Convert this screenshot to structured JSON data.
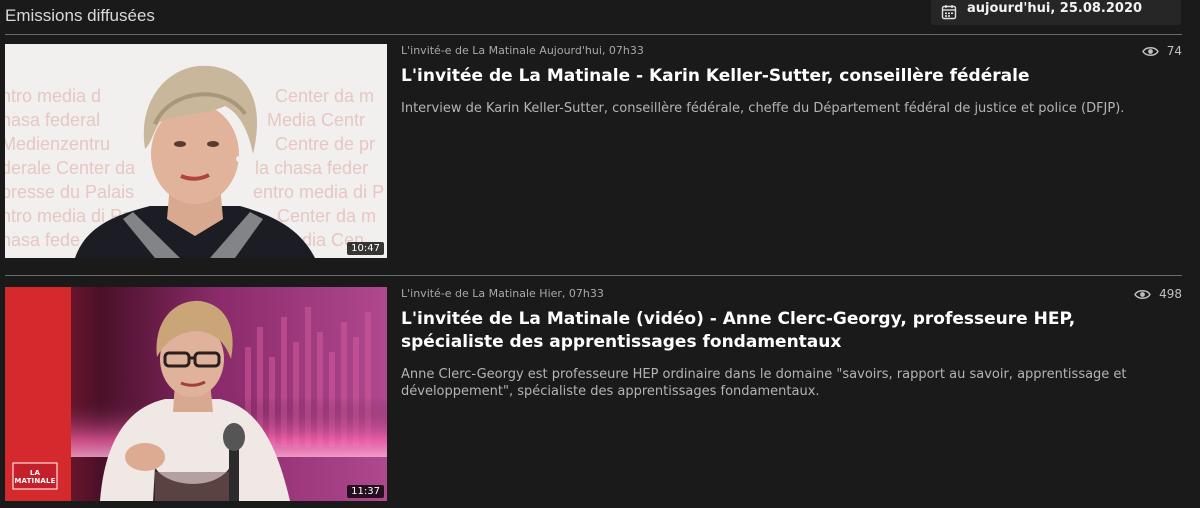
{
  "header": {
    "section_title": "Emissions diffusées",
    "date_label": "aujourd'hui, 25.08.2020",
    "date_icon": "calendar-icon"
  },
  "episodes": [
    {
      "meta": "L'invité-e de La Matinale Aujourd'hui, 07h33",
      "views": "74",
      "title": "L'invitée de La Matinale - Karin Keller-Sutter, conseillère fédérale",
      "description": "Interview de Karin Keller-Sutter, conseillère fédérale, cheffe du Département fédéral de justice et police (DFJP).",
      "duration": "10:47",
      "thumbnail": "press-conference-speaker"
    },
    {
      "meta": "L'invité-e de La Matinale Hier, 07h33",
      "views": "498",
      "title": "L'invitée de La Matinale (vidéo) - Anne Clerc-Georgy, professeure HEP, spécialiste des apprentissages fondamentaux",
      "description": "Anne Clerc-Georgy est professeure HEP ordinaire dans le domaine \"savoirs, rapport au savoir, apprentissage et développement\", spécialiste des apprentissages fondamentaux.",
      "duration": "11:37",
      "thumbnail": "studio-guest",
      "logo_text": "LA MATINALE"
    }
  ],
  "colors": {
    "background": "#1a1a1a",
    "accent_red": "#c4202b"
  }
}
